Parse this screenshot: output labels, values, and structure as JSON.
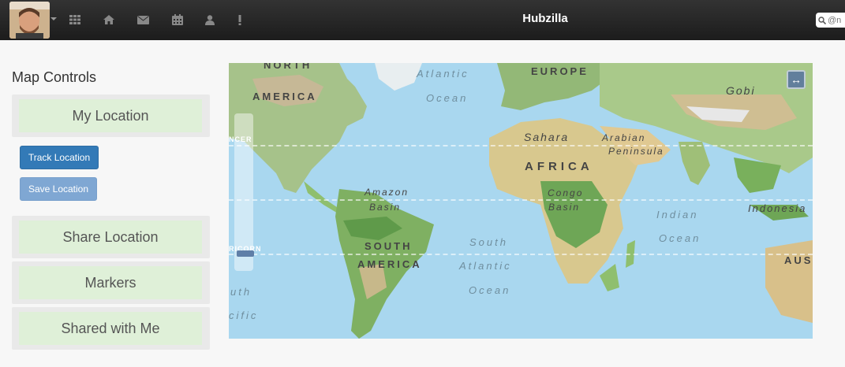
{
  "navbar": {
    "brand": "Hubzilla",
    "search_placeholder": "@n",
    "icons": [
      "avatar",
      "apps-grid-icon",
      "home-icon",
      "mail-icon",
      "calendar-icon",
      "profile-icon",
      "notifications-icon"
    ]
  },
  "sidebar": {
    "title": "Map Controls",
    "my_location": "My Location",
    "track_location": "Track Location",
    "save_location": "Save Location",
    "share_location": "Share Location",
    "markers": "Markers",
    "shared_with_me": "Shared with Me"
  },
  "map": {
    "labels": {
      "north": "NORTH",
      "america": "AMERICA",
      "atlantic": "Atlantic",
      "ocean": "Ocean",
      "europe": "EUROPE",
      "gobi": "Gobi",
      "sahara": "Sahara",
      "arabian": "Arabian",
      "peninsula": "Peninsula",
      "africa": "AFRICA",
      "amazon": "Amazon",
      "basin": "Basin",
      "congo": "Congo",
      "congo_basin": "Basin",
      "indian": "Indian",
      "indian_ocean": "Ocean",
      "indonesia": "Indonesia",
      "south": "SOUTH",
      "south_america": "AMERICA",
      "south_atlantic_1": "South",
      "south_atlantic_2": "Atlantic",
      "south_atlantic_3": "Ocean",
      "aus": "AUS",
      "cancer": "NCER",
      "capricorn": "RICORN",
      "uth": "uth",
      "cific": "cific"
    },
    "fullscreen_label": "↔"
  },
  "colors": {
    "navbar": "#222222",
    "panel_button": "#dff0d8",
    "primary": "#337ab7",
    "ocean": "#a9d7ef",
    "land": "#a9c98a"
  }
}
